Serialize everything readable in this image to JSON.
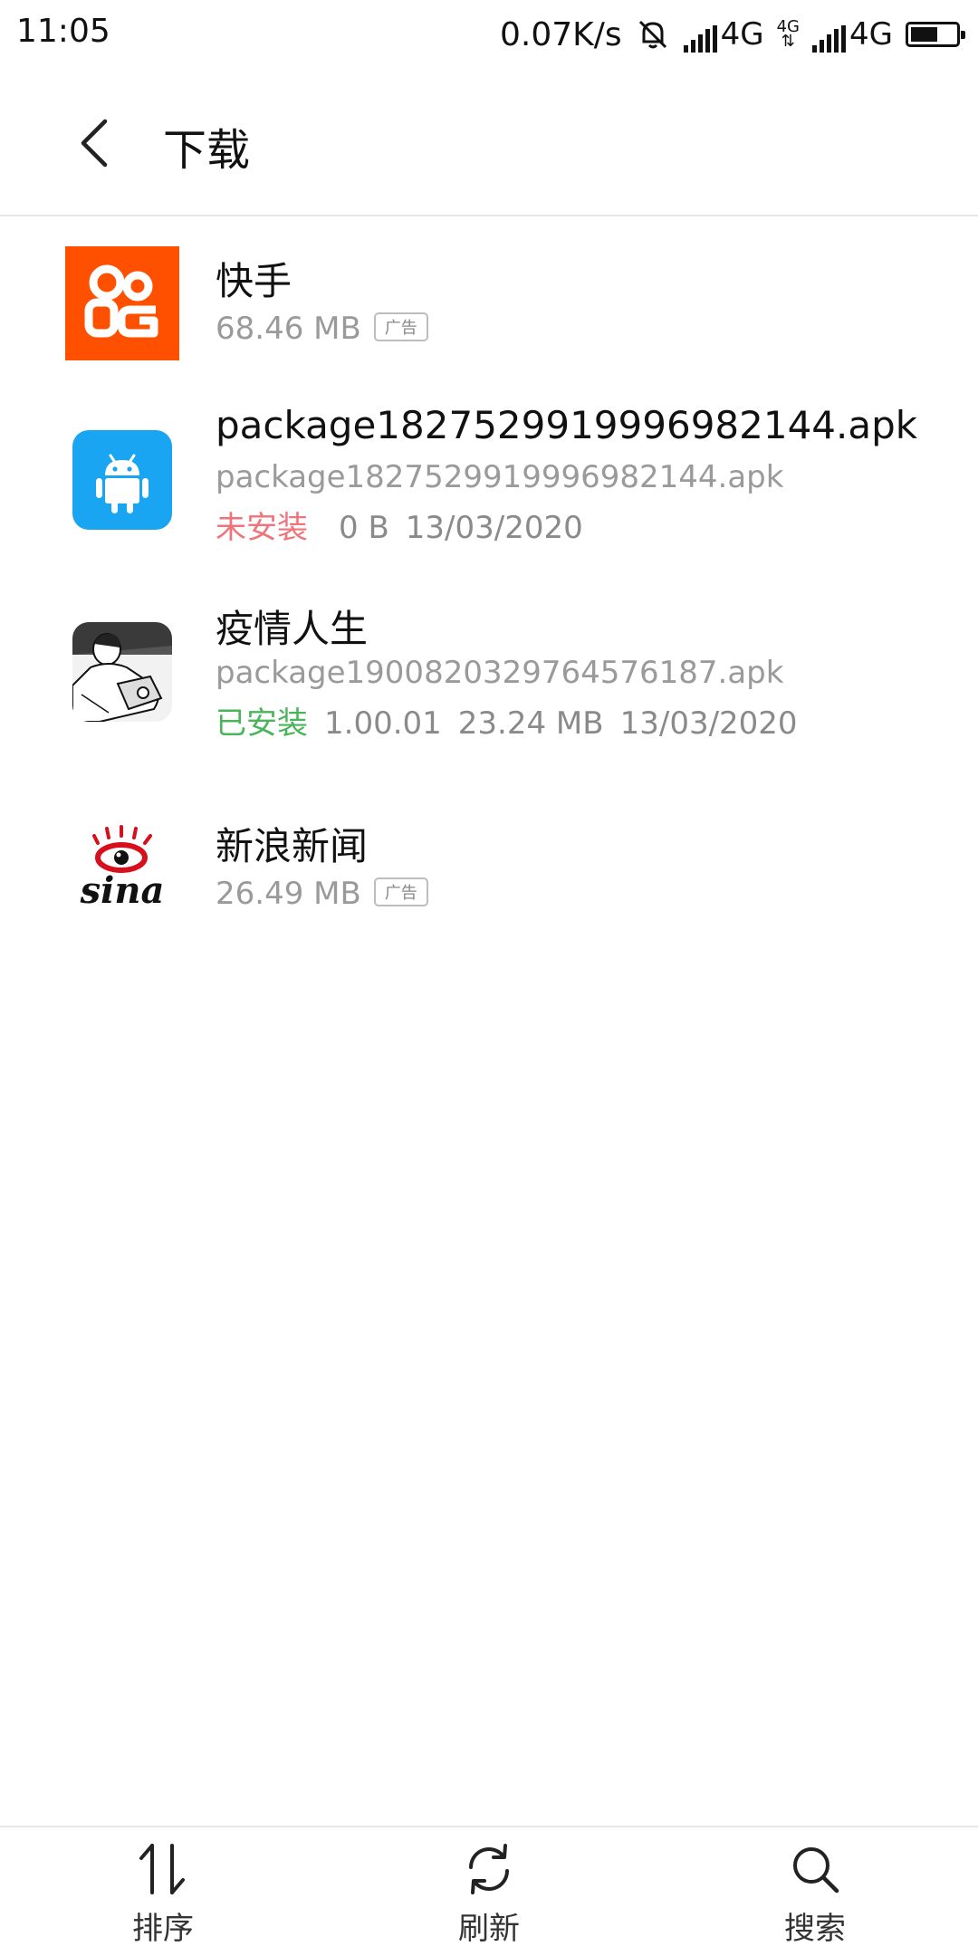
{
  "status_bar": {
    "time": "11:05",
    "speed": "0.07K/s",
    "net1": "4G",
    "net2_small": "4G",
    "net2": "4G",
    "battery_level": 0.6
  },
  "header": {
    "title": "下载"
  },
  "downloads": [
    {
      "name": "快手",
      "size": "68.46 MB",
      "badge": "广告"
    },
    {
      "name": "package1827529919996982144.apk",
      "file": "package1827529919996982144.apk",
      "status": "未安装",
      "size": "0 B",
      "date": "13/03/2020"
    },
    {
      "name": "疫情人生",
      "file": "package1900820329764576187.apk",
      "status": "已安装",
      "version": "1.00.01",
      "size": "23.24 MB",
      "date": "13/03/2020"
    },
    {
      "name": "新浪新闻",
      "size": "26.49 MB",
      "badge": "广告",
      "logo_text": "sina"
    }
  ],
  "bottom_bar": {
    "sort": "排序",
    "refresh": "刷新",
    "search": "搜索"
  },
  "colors": {
    "kuaishou_orange": "#ff5000",
    "android_blue": "#1aa5f2",
    "not_installed_red": "#f0737a",
    "installed_green": "#49b55a",
    "sina_red": "#d6101c"
  }
}
